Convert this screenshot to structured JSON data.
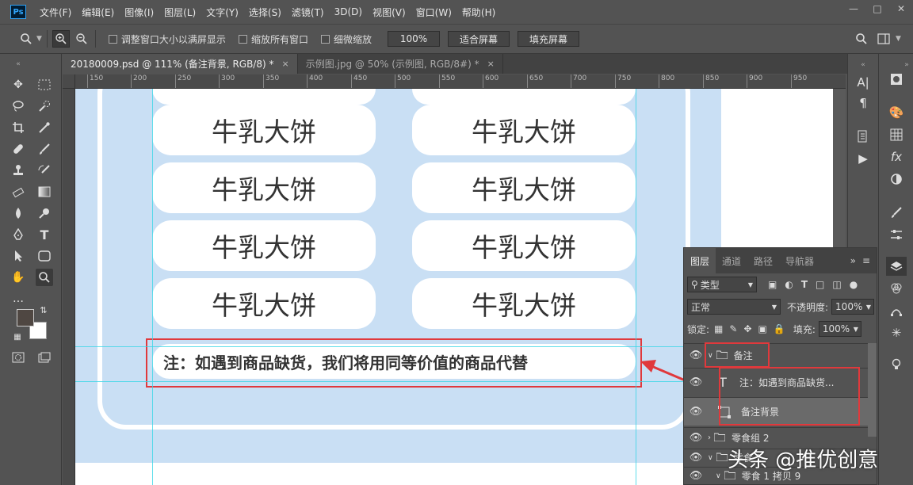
{
  "app": {
    "logo": "Ps",
    "menus": [
      "文件(F)",
      "编辑(E)",
      "图像(I)",
      "图层(L)",
      "文字(Y)",
      "选择(S)",
      "滤镜(T)",
      "3D(D)",
      "视图(V)",
      "窗口(W)",
      "帮助(H)"
    ]
  },
  "options": {
    "resize_windows": "调整窗口大小以满屏显示",
    "zoom_all": "缩放所有窗口",
    "scrubby_zoom": "细微缩放",
    "zoom_value": "100%",
    "fit_screen": "适合屏幕",
    "fill_screen": "填充屏幕"
  },
  "tabs": [
    {
      "label": "20180009.psd @ 111% (备注背景, RGB/8) *",
      "close": "×"
    },
    {
      "label": "示例图.jpg @ 50% (示例图, RGB/8#) *",
      "close": "×"
    }
  ],
  "ruler": {
    "h": [
      "150",
      "200",
      "250",
      "300",
      "350",
      "400",
      "450",
      "500",
      "550",
      "600",
      "650",
      "700",
      "750",
      "800",
      "850",
      "900",
      "950"
    ]
  },
  "canvas": {
    "item_label": "牛乳大饼",
    "note_text": "注：如遇到商品缺货，我们将用同等价值的商品代替"
  },
  "layers_panel": {
    "tabs": [
      "图层",
      "通道",
      "路径",
      "导航器"
    ],
    "filter_kind": "类型",
    "blend_mode": "正常",
    "opacity_label": "不透明度:",
    "opacity_value": "100%",
    "lock_label": "锁定:",
    "fill_label": "填充:",
    "fill_value": "100%",
    "layers": [
      {
        "name": "备注",
        "type": "group"
      },
      {
        "name": "注：如遇到商品缺货...",
        "type": "text"
      },
      {
        "name": "备注背景",
        "type": "shape"
      },
      {
        "name": "零食组 2",
        "type": "group"
      },
      {
        "name": "零食 1",
        "type": "group"
      },
      {
        "name": "零食 1 拷贝 9",
        "type": "group"
      }
    ]
  },
  "watermark": "头条 @推优创意",
  "colors": {
    "canvas_blue": "#c9dff4",
    "highlight_red": "#e0393c",
    "guide_cyan": "#39d6e6"
  }
}
